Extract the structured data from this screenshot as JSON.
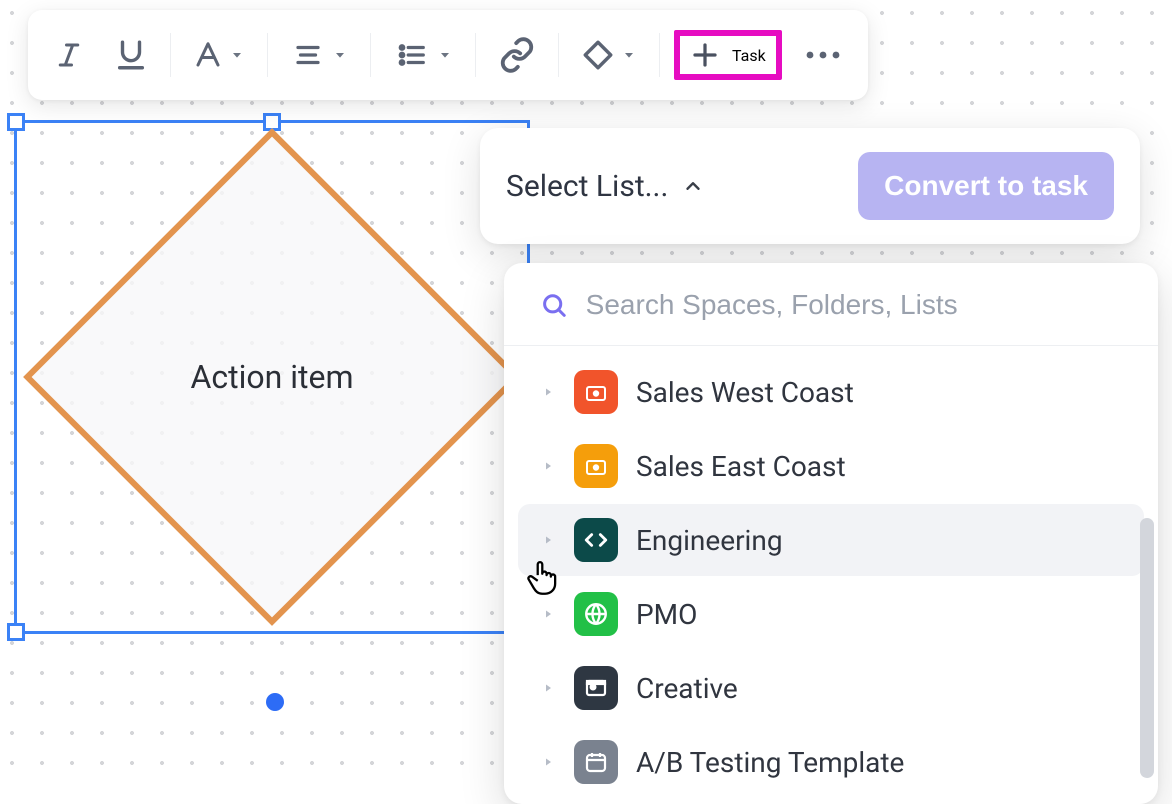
{
  "toolbar": {
    "task_label": "Task"
  },
  "shape": {
    "label": "Action item"
  },
  "select_list": {
    "title": "Select List...",
    "convert_label": "Convert to task"
  },
  "picker": {
    "search_placeholder": "Search Spaces, Folders, Lists",
    "spaces": [
      {
        "label": "Sales West Coast",
        "color": "#f1542b",
        "icon": "camera"
      },
      {
        "label": "Sales East Coast",
        "color": "#f59e0b",
        "icon": "camera"
      },
      {
        "label": "Engineering",
        "color": "#0c4a49",
        "icon": "code",
        "hovered": true
      },
      {
        "label": "PMO",
        "color": "#22c047",
        "icon": "globe"
      },
      {
        "label": "Creative",
        "color": "#2e3742",
        "icon": "photo"
      },
      {
        "label": "A/B Testing Template",
        "color": "#7a828f",
        "icon": "calendar"
      }
    ]
  }
}
